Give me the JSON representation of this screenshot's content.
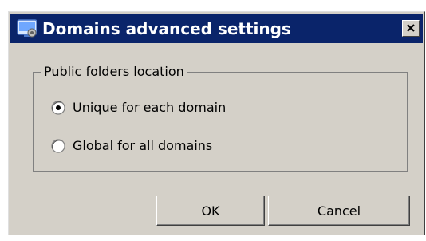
{
  "window": {
    "title": "Domains advanced settings",
    "icon": "app-settings-icon",
    "close_icon": "close-icon"
  },
  "group": {
    "legend": "Public folders location",
    "options": [
      {
        "label": "Unique for each domain",
        "selected": true
      },
      {
        "label": "Global for all domains",
        "selected": false
      }
    ]
  },
  "buttons": {
    "ok_label": "OK",
    "cancel_label": "Cancel"
  },
  "colors": {
    "titlebar": "#0a246a",
    "dialog_face": "#d4d0c8"
  }
}
